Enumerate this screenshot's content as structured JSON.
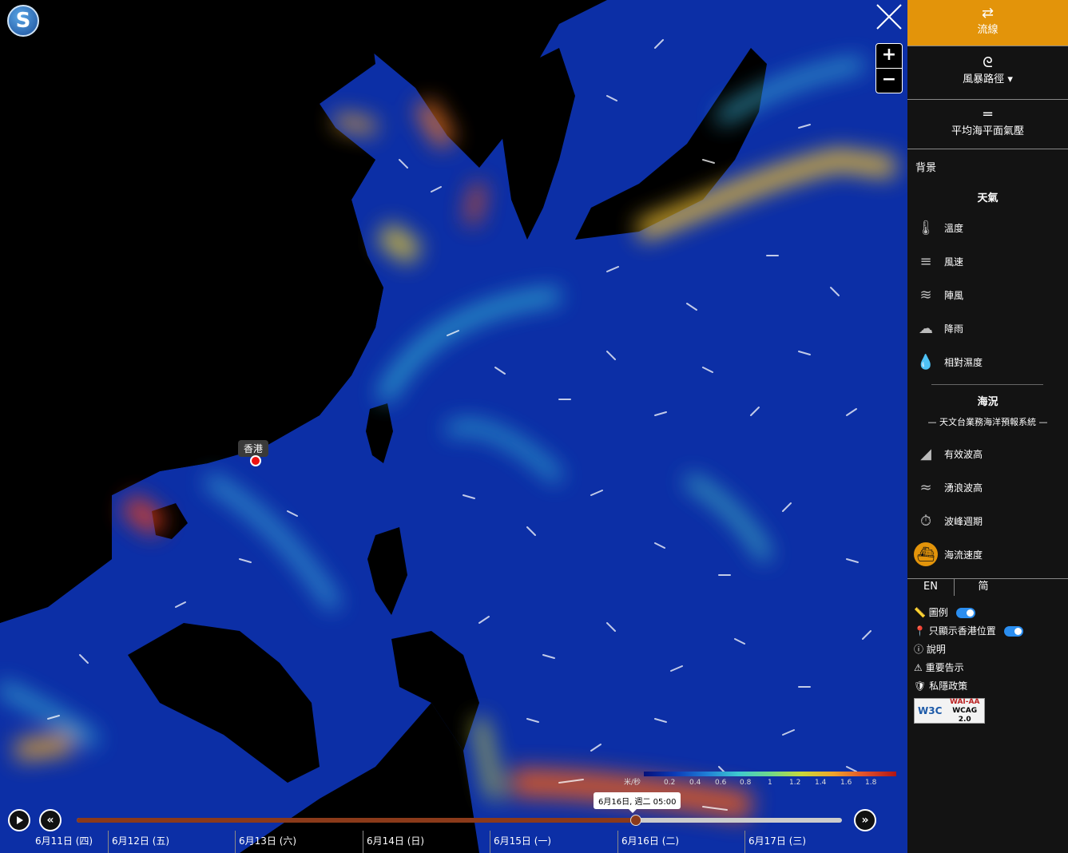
{
  "header": {
    "logo_letter": "S"
  },
  "map": {
    "hk_label": "香港"
  },
  "legend": {
    "unit": "米/秒",
    "ticks": [
      "0.2",
      "0.4",
      "0.6",
      "0.8",
      "1",
      "1.2",
      "1.4",
      "1.6",
      "1.8"
    ]
  },
  "timeline": {
    "tooltip": "6月16日, 週二 05:00",
    "progress": 0.73,
    "days": [
      "6月11日 (四)",
      "6月12日 (五)",
      "6月13日 (六)",
      "6月14日 (日)",
      "6月15日 (一)",
      "6月16日 (二)",
      "6月17日 (三)"
    ]
  },
  "panel": {
    "streamline_label": "流線",
    "typhoon_label": "風暴路徑",
    "pressure_label": "平均海平面氣壓",
    "background_label": "背景",
    "weather_title": "天氣",
    "weather_items": [
      "溫度",
      "風速",
      "陣風",
      "降雨",
      "相對濕度"
    ],
    "sea_title": "海況",
    "sea_subtitle": "— 天文台業務海洋預報系統 —",
    "sea_items": [
      "有效波高",
      "湧浪波高",
      "波峰週期",
      "海流速度"
    ],
    "lang_en": "EN",
    "lang_sc": "简",
    "legend_toggle": "圖例",
    "hk_only_toggle": "只顯示香港位置",
    "help": "說明",
    "notice": "重要告示",
    "privacy": "私隱政策",
    "wcag_line1": "WAI-AA",
    "wcag_line2": "WCAG 2.0",
    "w3c": "W3C"
  },
  "colors": {
    "accent": "#e3940a",
    "track": "#8b3a1a",
    "toggle": "#2b8ef0"
  }
}
